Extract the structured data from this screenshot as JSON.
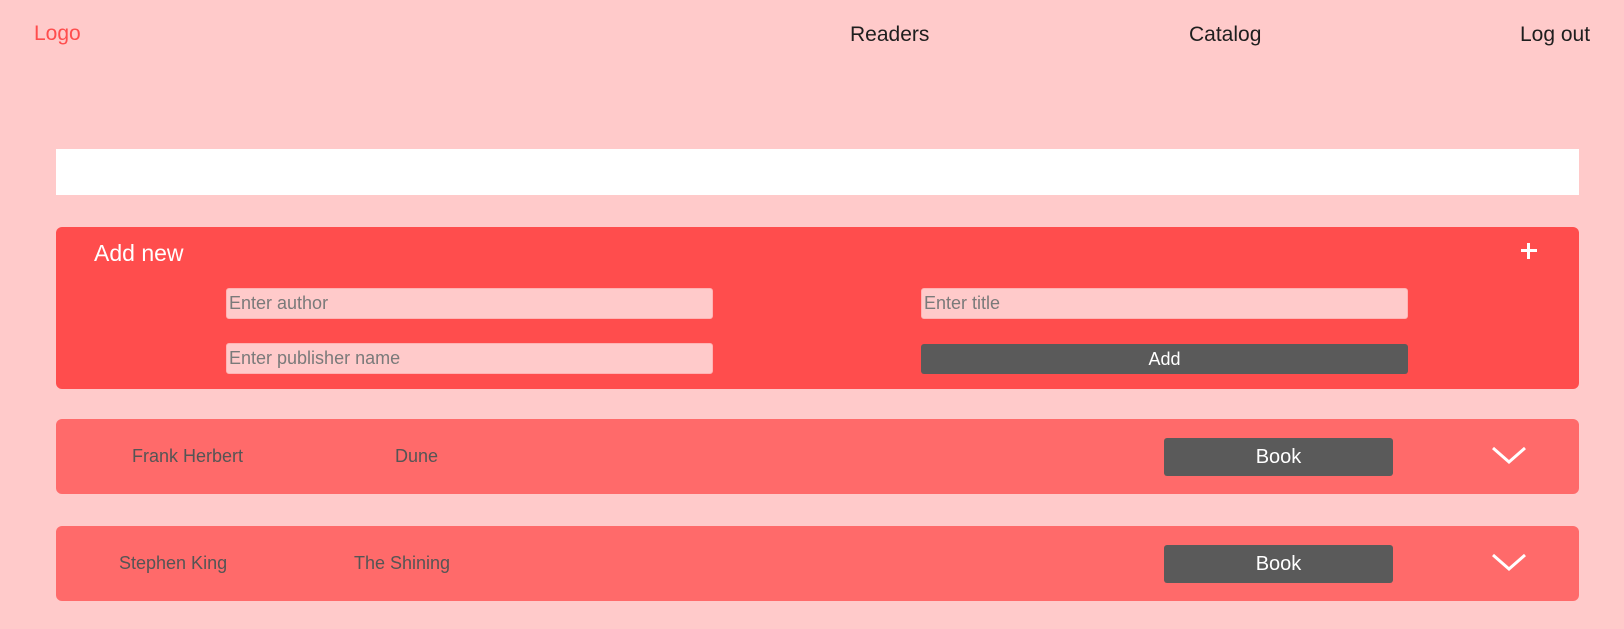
{
  "nav": {
    "logo": "Logo",
    "links": [
      "Readers",
      "Catalog",
      "Log out"
    ]
  },
  "search": {
    "value": "",
    "placeholder": ""
  },
  "add_panel": {
    "title": "Add new",
    "author_placeholder": "Enter author",
    "title_placeholder": "Enter title",
    "publisher_placeholder": "Enter publisher name",
    "add_label": "Add",
    "toggle_icon": "plus-icon"
  },
  "books": [
    {
      "author": "Frank Herbert",
      "title": "Dune",
      "action_label": "Book",
      "expand_icon": "chevron-down-icon"
    },
    {
      "author": "Stephen King",
      "title": "The Shining",
      "action_label": "Book",
      "expand_icon": "chevron-down-icon"
    }
  ],
  "colors": {
    "background": "#ffcaca",
    "accent": "#ff4d4d",
    "row": "#ff6a6a",
    "button": "#5a5a5a"
  }
}
